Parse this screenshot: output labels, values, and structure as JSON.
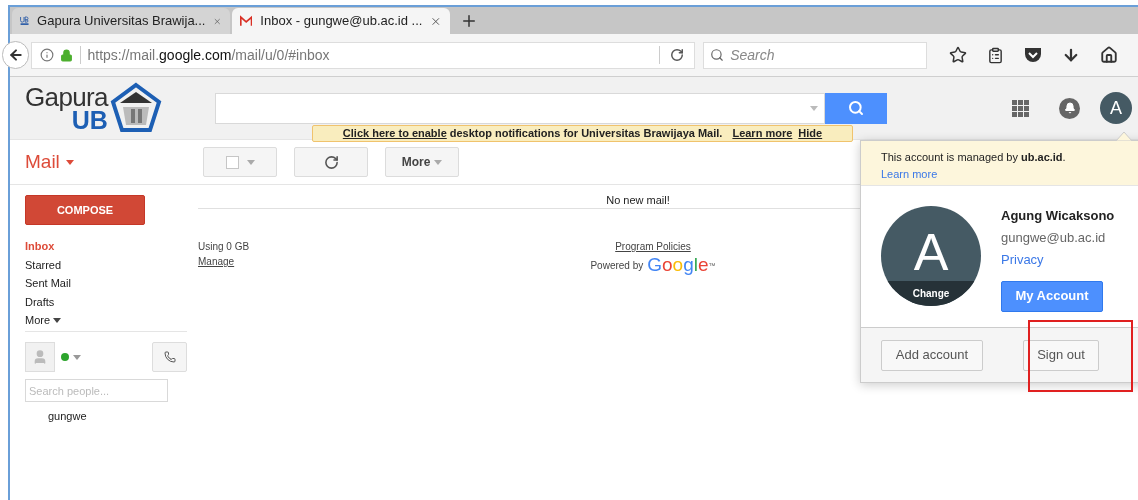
{
  "browser": {
    "tabs": [
      {
        "title": "Gapura Universitas Brawija...",
        "selected": false
      },
      {
        "title": "Inbox - gungwe@ub.ac.id ...",
        "selected": true
      }
    ],
    "url": {
      "prefix": "https://mail.",
      "domain": "google.com",
      "path": "/mail/u/0/#inbox"
    },
    "search_placeholder": "Search"
  },
  "header": {
    "logo": {
      "top": "Gapura",
      "bottom": "UB"
    },
    "avatar_letter": "A"
  },
  "notification": {
    "link": "Click here to enable",
    "text": "desktop notifications for Universitas Brawijaya Mail.",
    "learn_more": "Learn more",
    "hide": "Hide"
  },
  "toolbar": {
    "mail_label": "Mail",
    "select_all_checked": false,
    "more_button": "More"
  },
  "sidebar": {
    "compose": "COMPOSE",
    "items": [
      {
        "label": "Inbox",
        "selected": true
      },
      {
        "label": "Starred",
        "selected": false
      },
      {
        "label": "Sent Mail",
        "selected": false
      },
      {
        "label": "Drafts",
        "selected": false
      }
    ],
    "more": "More",
    "search_people_placeholder": "Search people...",
    "contacts": [
      "gungwe"
    ]
  },
  "main": {
    "empty_message": "No new mail!",
    "storage": "Using 0 GB",
    "manage": "Manage",
    "program_policies": "Program Policies",
    "powered_by": "Powered by",
    "google": "Google",
    "trademark": "™"
  },
  "account_popup": {
    "managed_notice": "This account is managed by **ub.ac.id**.",
    "learn_more": "Learn more",
    "avatar_letter": "A",
    "change": "Change",
    "name": "Agung Wicaksono",
    "email": "gungwe@ub.ac.id",
    "privacy": "Privacy",
    "my_account": "My Account",
    "add_account": "Add account",
    "sign_out": "Sign out"
  }
}
